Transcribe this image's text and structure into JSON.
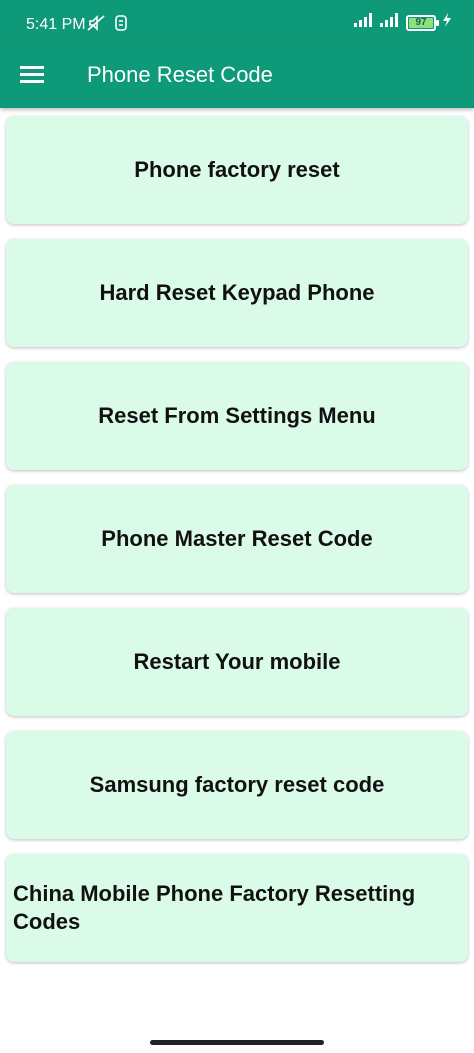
{
  "status_bar": {
    "time": "5:41 PM",
    "battery_level": "97",
    "icons": [
      "mute-icon",
      "notification-icon",
      "signal-icon",
      "signal-icon",
      "battery-icon",
      "charging-icon"
    ]
  },
  "app_bar": {
    "title": "Phone Reset Code",
    "menu_icon": "menu-icon"
  },
  "items": [
    {
      "label": "Phone factory reset"
    },
    {
      "label": "Hard Reset Keypad Phone"
    },
    {
      "label": "Reset From Settings Menu"
    },
    {
      "label": "Phone Master Reset Code"
    },
    {
      "label": "Restart Your mobile"
    },
    {
      "label": "Samsung factory reset code"
    },
    {
      "label": "China Mobile Phone Factory Resetting Codes"
    }
  ],
  "colors": {
    "primary": "#0e9a78",
    "card_background": "#dbfbe9",
    "text": "#111111"
  }
}
